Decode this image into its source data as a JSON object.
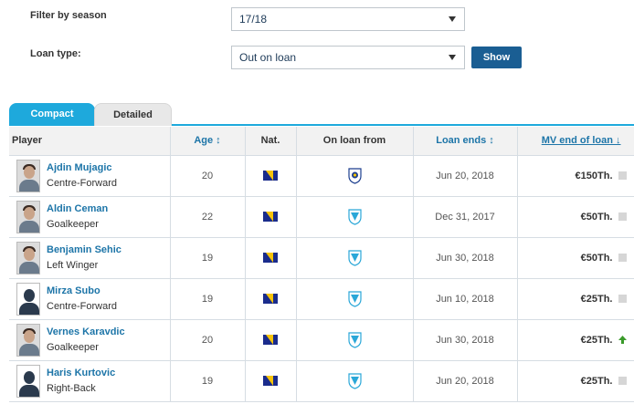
{
  "filters": {
    "season_label": "Filter by season",
    "season_value": "17/18",
    "loan_type_label": "Loan type:",
    "loan_type_value": "Out on loan",
    "show_label": "Show"
  },
  "tabs": [
    {
      "label": "Compact",
      "active": true
    },
    {
      "label": "Detailed",
      "active": false
    }
  ],
  "table": {
    "headers": {
      "player": "Player",
      "age": "Age ↕",
      "nat": "Nat.",
      "on_loan_from": "On loan from",
      "loan_ends": "Loan ends ↕",
      "mv": "MV end of loan ↓"
    },
    "rows": [
      {
        "name": "Ajdin Mujagic",
        "position": "Centre-Forward",
        "age": "20",
        "nat": "Bosnia-Herzegovina",
        "club_icon": "club-crest-icon-a",
        "loan_ends": "Jun 20, 2018",
        "mv": "€150Th.",
        "trend": "none",
        "photo": "photo"
      },
      {
        "name": "Aldin Ceman",
        "position": "Goalkeeper",
        "age": "22",
        "nat": "Bosnia-Herzegovina",
        "club_icon": "club-crest-icon-b",
        "loan_ends": "Dec 31, 2017",
        "mv": "€50Th.",
        "trend": "none",
        "photo": "photo"
      },
      {
        "name": "Benjamin Sehic",
        "position": "Left Winger",
        "age": "19",
        "nat": "Bosnia-Herzegovina",
        "club_icon": "club-crest-icon-b",
        "loan_ends": "Jun 30, 2018",
        "mv": "€50Th.",
        "trend": "none",
        "photo": "photo"
      },
      {
        "name": "Mirza Subo",
        "position": "Centre-Forward",
        "age": "19",
        "nat": "Bosnia-Herzegovina",
        "club_icon": "club-crest-icon-b",
        "loan_ends": "Jun 10, 2018",
        "mv": "€25Th.",
        "trend": "none",
        "photo": "silhouette"
      },
      {
        "name": "Vernes Karavdic",
        "position": "Goalkeeper",
        "age": "20",
        "nat": "Bosnia-Herzegovina",
        "club_icon": "club-crest-icon-b",
        "loan_ends": "Jun 30, 2018",
        "mv": "€25Th.",
        "trend": "up",
        "photo": "photo"
      },
      {
        "name": "Haris Kurtovic",
        "position": "Right-Back",
        "age": "19",
        "nat": "Bosnia-Herzegovina",
        "club_icon": "club-crest-icon-b",
        "loan_ends": "Jun 20, 2018",
        "mv": "€25Th.",
        "trend": "none",
        "photo": "silhouette"
      }
    ]
  },
  "colors": {
    "accent": "#1ea9dc",
    "link": "#1d75a8",
    "button": "#1a5e93",
    "trend_up": "#3a9a2a",
    "trend_none": "#d6d6d6"
  }
}
